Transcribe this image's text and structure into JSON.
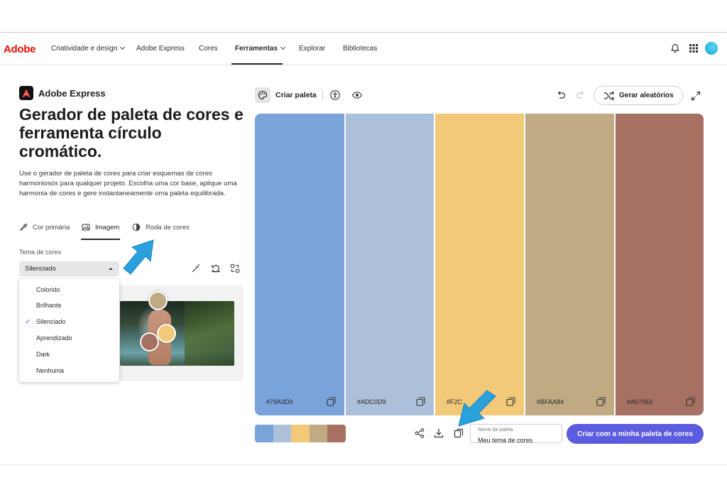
{
  "nav": {
    "logo": "Adobe",
    "items": [
      {
        "label": "Criatividade e design",
        "dropdown": true
      },
      {
        "label": "Adobe Express",
        "dropdown": false
      },
      {
        "label": "Cores",
        "dropdown": false
      },
      {
        "label": "Ferramentas",
        "dropdown": true,
        "active": true
      },
      {
        "label": "Explorar",
        "dropdown": false
      },
      {
        "label": "Bibliotecas",
        "dropdown": false
      }
    ],
    "icons": [
      "bell-icon",
      "apps-grid-icon",
      "avatar"
    ]
  },
  "left": {
    "brand": "Adobe Express",
    "title": "Gerador de paleta de cores e ferramenta círculo cromático.",
    "description": "Use o gerador de paleta de cores para criar esquemas de cores harmoniosos para qualquer projeto. Escolha uma cor base, aplique uma harmonia de cores e gere instantaneamente uma paleta equilibrada.",
    "tabs": [
      {
        "label": "Cor primária",
        "icon": "eyedropper-icon"
      },
      {
        "label": "Imagem",
        "icon": "image-icon",
        "active": true
      },
      {
        "label": "Roda de cores",
        "icon": "color-wheel-icon"
      }
    ],
    "theme_label": "Tema de cores",
    "theme_selected": "Silenciado",
    "theme_options": [
      "Colorido",
      "Brilhante",
      "Silenciado",
      "Aprendizado",
      "Dark",
      "Nenhuma"
    ]
  },
  "toolbar": {
    "create_label": "Criar paleta",
    "random_label": "Gerar aleatórios",
    "icons": [
      "palette-icon",
      "accessibility-icon",
      "eye-icon",
      "undo-icon",
      "redo-icon",
      "shuffle-icon",
      "expand-icon"
    ]
  },
  "palette": {
    "colors": [
      {
        "hex": "#79A3D9",
        "label": "#79A3D9"
      },
      {
        "hex": "#ADC0D9",
        "label": "#ADC0D9"
      },
      {
        "hex": "#F2C879",
        "label": "#F2C"
      },
      {
        "hex": "#BFAA84",
        "label": "#BFAA84"
      },
      {
        "hex": "#A67063",
        "label": "#A67063"
      }
    ]
  },
  "footer": {
    "name_label": "Nome da paleta",
    "name_value": "Meu tema de cores",
    "cta_label": "Criar com a minha paleta de cores",
    "icons": [
      "share-icon",
      "download-icon",
      "copy-palette-icon"
    ]
  },
  "pickers": [
    {
      "color": "#BFAA84"
    },
    {
      "color": "#F2C879"
    },
    {
      "color": "#A67063"
    }
  ],
  "accent": {
    "arrow": "#2aa0dc",
    "cta": "#5c5ce0"
  }
}
